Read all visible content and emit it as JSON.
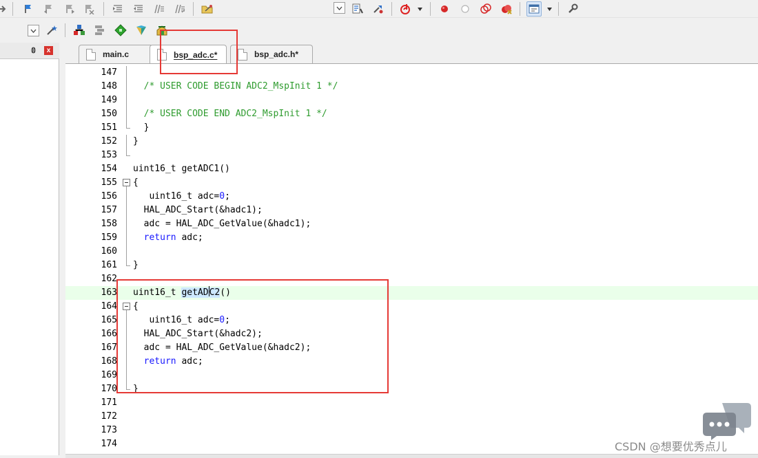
{
  "tabs": [
    {
      "label": "main.c",
      "active": false
    },
    {
      "label": "bsp_adc.c*",
      "active": true
    },
    {
      "label": "bsp_adc.h*",
      "active": false
    }
  ],
  "left_panel": {
    "pin_glyph": "⌂",
    "close_glyph": "x"
  },
  "editor": {
    "lines": [
      {
        "n": "147",
        "segs": [],
        "fold": "line"
      },
      {
        "n": "148",
        "segs": [
          {
            "t": "  /* USER CODE BEGIN ADC2_MspInit 1 */",
            "c": "cm"
          }
        ],
        "fold": "line"
      },
      {
        "n": "149",
        "segs": [],
        "fold": "line"
      },
      {
        "n": "150",
        "segs": [
          {
            "t": "  /* USER CODE END ADC2_MspInit 1 */",
            "c": "cm"
          }
        ],
        "fold": "line"
      },
      {
        "n": "151",
        "segs": [
          {
            "t": "  }",
            "c": ""
          }
        ],
        "fold": "end"
      },
      {
        "n": "152",
        "segs": [
          {
            "t": "}",
            "c": ""
          }
        ],
        "fold": "line"
      },
      {
        "n": "153",
        "segs": [],
        "fold": "end"
      },
      {
        "n": "154",
        "segs": [
          {
            "t": "uint16_t getADC1()",
            "c": ""
          }
        ],
        "fold": ""
      },
      {
        "n": "155",
        "segs": [
          {
            "t": "{",
            "c": ""
          }
        ],
        "fold": "box"
      },
      {
        "n": "156",
        "segs": [
          {
            "t": "   uint16_t adc=",
            "c": ""
          },
          {
            "t": "0",
            "c": "kw"
          },
          {
            "t": ";",
            "c": ""
          }
        ],
        "fold": "line"
      },
      {
        "n": "157",
        "segs": [
          {
            "t": "  HAL_ADC_Start(&hadc1);",
            "c": ""
          }
        ],
        "fold": "line"
      },
      {
        "n": "158",
        "segs": [
          {
            "t": "  adc = HAL_ADC_GetValue(&hadc1);",
            "c": ""
          }
        ],
        "fold": "line"
      },
      {
        "n": "159",
        "segs": [
          {
            "t": "  ",
            "c": ""
          },
          {
            "t": "return",
            "c": "kw"
          },
          {
            "t": " adc;",
            "c": ""
          }
        ],
        "fold": "line"
      },
      {
        "n": "160",
        "segs": [],
        "fold": "line"
      },
      {
        "n": "161",
        "segs": [
          {
            "t": "}",
            "c": ""
          }
        ],
        "fold": "end"
      },
      {
        "n": "162",
        "segs": [],
        "fold": ""
      },
      {
        "n": "163",
        "segs": [
          {
            "t": "uint16_t ",
            "c": ""
          },
          {
            "t": "getAD",
            "c": "sel"
          },
          {
            "t": "|",
            "c": "caret"
          },
          {
            "t": "C2",
            "c": "sel"
          },
          {
            "t": "()",
            "c": ""
          }
        ],
        "fold": "",
        "highlight": true
      },
      {
        "n": "164",
        "segs": [
          {
            "t": "{",
            "c": ""
          }
        ],
        "fold": "box"
      },
      {
        "n": "165",
        "segs": [
          {
            "t": "   uint16_t adc=",
            "c": ""
          },
          {
            "t": "0",
            "c": "kw"
          },
          {
            "t": ";",
            "c": ""
          }
        ],
        "fold": "line"
      },
      {
        "n": "166",
        "segs": [
          {
            "t": "  HAL_ADC_Start(&hadc2);",
            "c": ""
          }
        ],
        "fold": "line"
      },
      {
        "n": "167",
        "segs": [
          {
            "t": "  adc = HAL_ADC_GetValue(&hadc2);",
            "c": ""
          }
        ],
        "fold": "line"
      },
      {
        "n": "168",
        "segs": [
          {
            "t": "  ",
            "c": ""
          },
          {
            "t": "return",
            "c": "kw"
          },
          {
            "t": " adc;",
            "c": ""
          }
        ],
        "fold": "line"
      },
      {
        "n": "169",
        "segs": [],
        "fold": "line"
      },
      {
        "n": "170",
        "segs": [
          {
            "t": "}",
            "c": ""
          }
        ],
        "fold": "end"
      },
      {
        "n": "171",
        "segs": [],
        "fold": ""
      },
      {
        "n": "172",
        "segs": [],
        "fold": ""
      },
      {
        "n": "173",
        "segs": [],
        "fold": ""
      },
      {
        "n": "174",
        "segs": [],
        "fold": ""
      }
    ]
  },
  "watermark": {
    "text": "CSDN @想要优秀点儿"
  },
  "colors": {
    "comment": "#2e9b2e",
    "keyword": "#1818ff",
    "annotation": "#e53935",
    "current_line": "#eaffea"
  },
  "icons": {
    "toolbar1": [
      "forward-arrow-icon",
      "bookmark-icon",
      "prev-bookmark-icon",
      "next-bookmark-icon",
      "clear-bookmarks-icon",
      "indent-icon",
      "unindent-icon",
      "comment-icon",
      "uncomment-icon",
      "find-in-files-icon",
      "dropdown-icon",
      "incremental-find-icon",
      "debug-session-icon",
      "debug-start-icon",
      "breakpoint-icon",
      "disable-breakpoint-icon",
      "kill-breakpoints-icon",
      "window-layout-icon",
      "configure-icon"
    ],
    "toolbar2": [
      "target-options-icon",
      "wizard-icon",
      "pack-installer-icon",
      "manage-components-icon",
      "select-software-packs-icon",
      "rte-icon",
      "event-recorder-icon"
    ]
  }
}
